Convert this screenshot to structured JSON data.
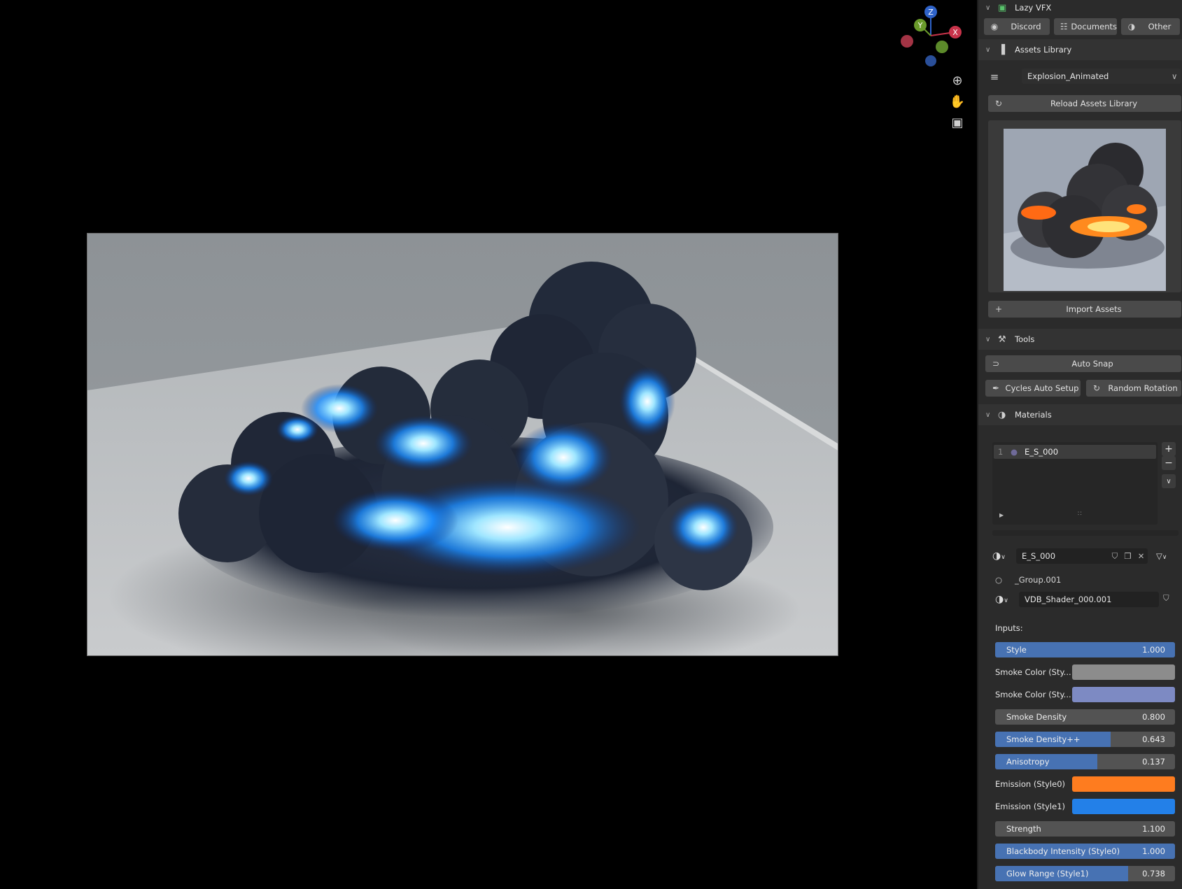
{
  "gizmo": {
    "z": "Z",
    "y": "Y",
    "x": "X"
  },
  "nav_icons": [
    "zoom-icon",
    "pan-hand-icon",
    "camera-icon"
  ],
  "sidebar": {
    "lazy_vfx": {
      "title": "Lazy VFX",
      "buttons": [
        {
          "label": "Discord",
          "icon": "discord-icon"
        },
        {
          "label": "Documents",
          "icon": "documents-icon"
        },
        {
          "label": "Other",
          "icon": "globe-icon"
        }
      ]
    },
    "assets": {
      "title": "Assets Library",
      "selected_asset": "Explosion_Animated",
      "reload_label": "Reload Assets Library",
      "import_label": "Import Assets"
    },
    "tools": {
      "title": "Tools",
      "auto_snap_label": "Auto Snap",
      "cycles_label": "Cycles Auto Setup",
      "random_rotation_label": "Random Rotation"
    },
    "materials": {
      "title": "Materials",
      "slot_index": "1",
      "slot_name": "E_S_000",
      "material_name": "E_S_000",
      "group_name": "_Group.001",
      "shader_name": "VDB_Shader_000.001",
      "inputs_label": "Inputs:",
      "inputs": {
        "style": {
          "label": "Style",
          "value": "1.000",
          "fraction": 1.0
        },
        "smoke_color_0": {
          "label": "Smoke Color (Sty...",
          "color": "#8c8c8c"
        },
        "smoke_color_1": {
          "label": "Smoke Color (Sty...",
          "color": "#7d8ac3"
        },
        "smoke_density": {
          "label": "Smoke Density",
          "value": "0.800",
          "fraction": 0.0
        },
        "smoke_density_pp": {
          "label": "Smoke Density++",
          "value": "0.643",
          "fraction": 0.643
        },
        "anisotropy": {
          "label": "Anisotropy",
          "value": "0.137",
          "fraction": 0.57
        },
        "emission_0": {
          "label": "Emission (Style0)",
          "color": "#fe7c1f"
        },
        "emission_1": {
          "label": "Emission (Style1)",
          "color": "#2380e8"
        },
        "strength": {
          "label": "Strength",
          "value": "1.100",
          "fraction": 0.0
        },
        "blackbody": {
          "label": "Blackbody Intensity  (Style0)",
          "value": "1.000",
          "fraction": 1.0
        },
        "glow_range": {
          "label": "Glow Range (Style1)",
          "value": "0.738",
          "fraction": 0.738
        }
      }
    }
  }
}
